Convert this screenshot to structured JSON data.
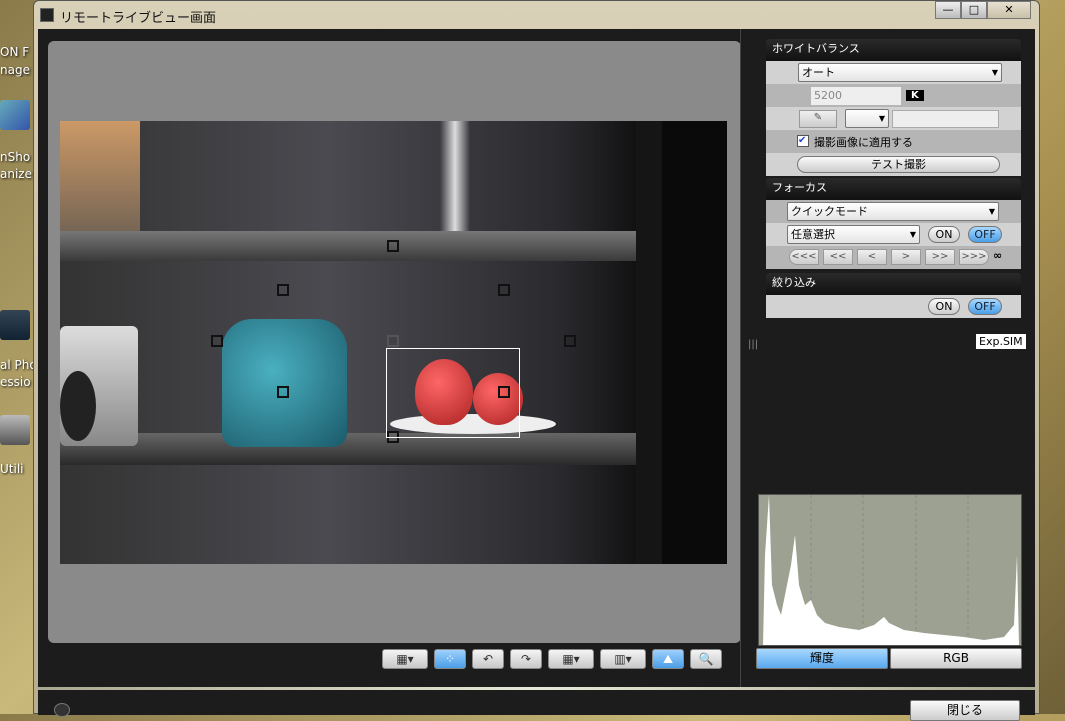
{
  "desktop": {
    "labels": [
      "ON F",
      "nage",
      "nSho",
      "anize",
      "al Pho",
      "essio",
      "Utili"
    ]
  },
  "window": {
    "title": "リモートライブビュー画面",
    "min": "—",
    "max": "□",
    "close": "✕"
  },
  "white_balance": {
    "header": "ホワイトバランス",
    "mode": "オート",
    "kelvin_value": "5200",
    "kelvin_unit": "K",
    "picker_icon": "eyedropper-icon",
    "apply_label": "撮影画像に適用する",
    "apply_checked": true,
    "test_shot": "テスト撮影"
  },
  "focus": {
    "header": "フォーカス",
    "mode": "クイックモード",
    "af_point": "任意選択",
    "on": "ON",
    "off": "OFF",
    "nav": [
      "<<<",
      "<<",
      "<",
      ">",
      ">>",
      ">>>"
    ],
    "infinity": "∞"
  },
  "dof": {
    "header": "絞り込み",
    "on": "ON",
    "off": "OFF"
  },
  "exp_sim": "Exp.SIM",
  "histogram": {
    "luminance": "輝度",
    "rgb": "RGB"
  },
  "toolbar": {
    "icons": [
      "aspect-ratio-icon",
      "af-frame-icon",
      "rotate-left-icon",
      "rotate-right-icon",
      "grid-icon",
      "crop-guide-icon",
      "histogram-toggle-icon",
      "zoom-icon"
    ]
  },
  "footer": {
    "close": "閉じる"
  }
}
